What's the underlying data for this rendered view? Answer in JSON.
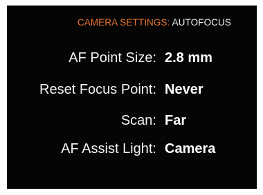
{
  "header": {
    "section": "CAMERA SETTINGS:",
    "subsection": "AUTOFOCUS"
  },
  "settings": [
    {
      "label": "AF Point Size:",
      "value": "2.8 mm"
    },
    {
      "label": "Reset Focus Point:",
      "value": "Never"
    },
    {
      "label": "Scan:",
      "value": "Far"
    },
    {
      "label": "AF Assist Light:",
      "value": "Camera"
    }
  ],
  "colors": {
    "background": "#050505",
    "accent": "#e8742f",
    "text": "#f2f2f2"
  }
}
